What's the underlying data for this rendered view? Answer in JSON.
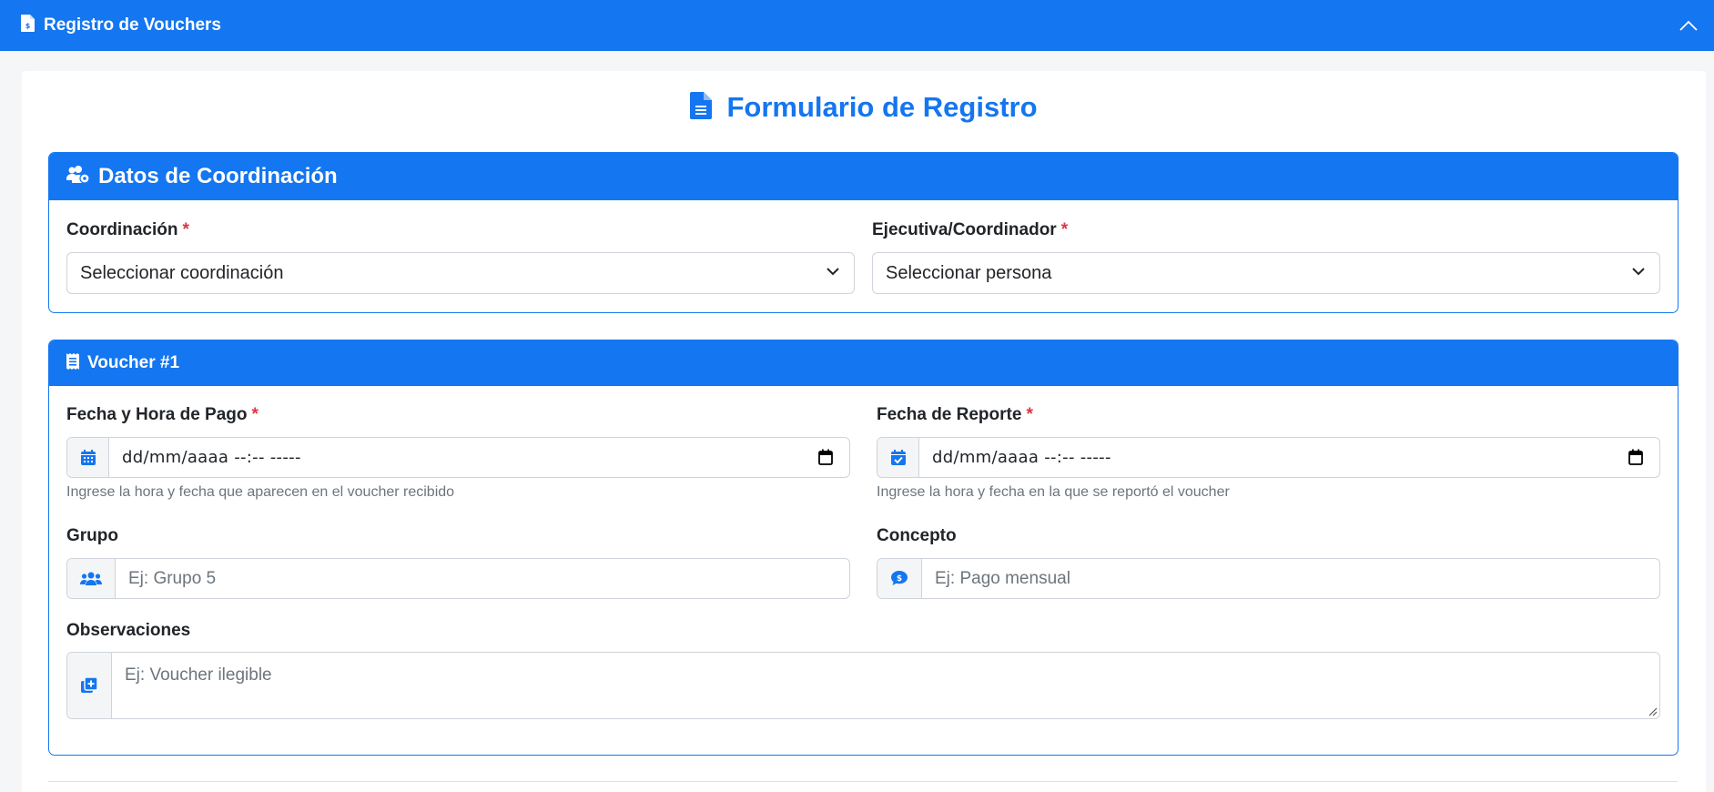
{
  "topbar": {
    "title": "Registro de Vouchers",
    "icon": "file-invoice-dollar-icon",
    "collapse_icon": "chevron-up-icon"
  },
  "form": {
    "title": "Formulario de Registro",
    "icon": "file-lines-icon"
  },
  "coordination": {
    "header": "Datos de Coordinación",
    "icon": "users-gear-icon",
    "coordinacion": {
      "label": "Coordinación",
      "required": "*",
      "value": "Seleccionar coordinación"
    },
    "ejecutiva": {
      "label": "Ejecutiva/Coordinador",
      "required": "*",
      "value": "Seleccionar persona"
    }
  },
  "voucher": {
    "header": "Voucher #1",
    "icon": "receipt-icon",
    "fecha_pago": {
      "label": "Fecha y Hora de Pago",
      "required": "*",
      "value": "dd/mm/aaaa --:-- -----",
      "help": "Ingrese la hora y fecha que aparecen en el voucher recibido"
    },
    "fecha_reporte": {
      "label": "Fecha de Reporte",
      "required": "*",
      "value": "dd/mm/aaaa --:-- -----",
      "help": "Ingrese la hora y fecha en la que se reportó el voucher"
    },
    "grupo": {
      "label": "Grupo",
      "placeholder": "Ej: Grupo 5"
    },
    "concepto": {
      "label": "Concepto",
      "placeholder": "Ej: Pago mensual"
    },
    "observaciones": {
      "label": "Observaciones",
      "placeholder": "Ej: Voucher ilegible"
    }
  },
  "colors": {
    "primary": "#1476f0",
    "required": "#dc3545",
    "help": "#6c757d"
  }
}
